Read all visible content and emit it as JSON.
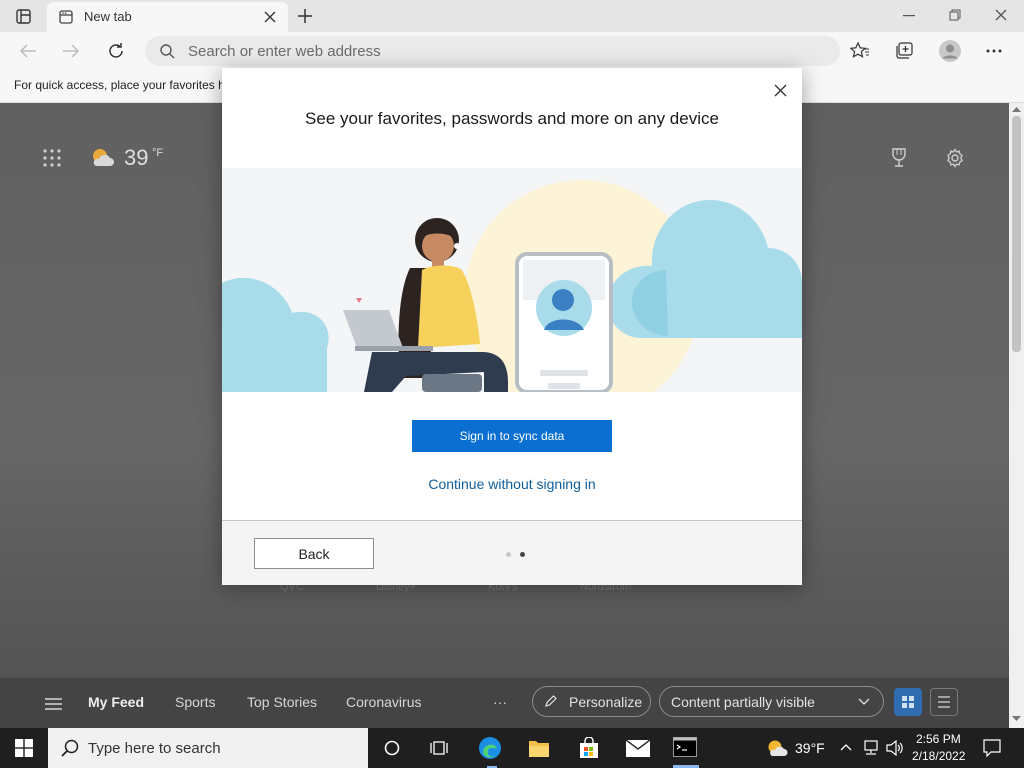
{
  "browser": {
    "tab_title": "New tab",
    "address_placeholder": "Search or enter web address",
    "favorites_bar_text": "For quick access, place your favorites h"
  },
  "page": {
    "weather_temp": "39",
    "weather_unit": "°F",
    "ghost_links": [
      "QVC",
      "Disney+",
      "Kohl's",
      "Nordstrom"
    ],
    "feed": {
      "items": [
        "My Feed",
        "Sports",
        "Top Stories",
        "Coronavirus"
      ],
      "more": "···",
      "personalize": "Personalize",
      "content_visibility": "Content partially visible"
    }
  },
  "dialog": {
    "title": "See your favorites, passwords and more on any device",
    "primary_button": "Sign in to sync data",
    "secondary_link": "Continue without signing in",
    "back_button": "Back",
    "pager": {
      "total": 2,
      "current": 2
    }
  },
  "taskbar": {
    "search_placeholder": "Type here to search",
    "weather": "39°F",
    "time": "2:56 PM",
    "date": "2/18/2022"
  },
  "colors": {
    "accent": "#0a6fd0",
    "link": "#0f5e9c"
  }
}
